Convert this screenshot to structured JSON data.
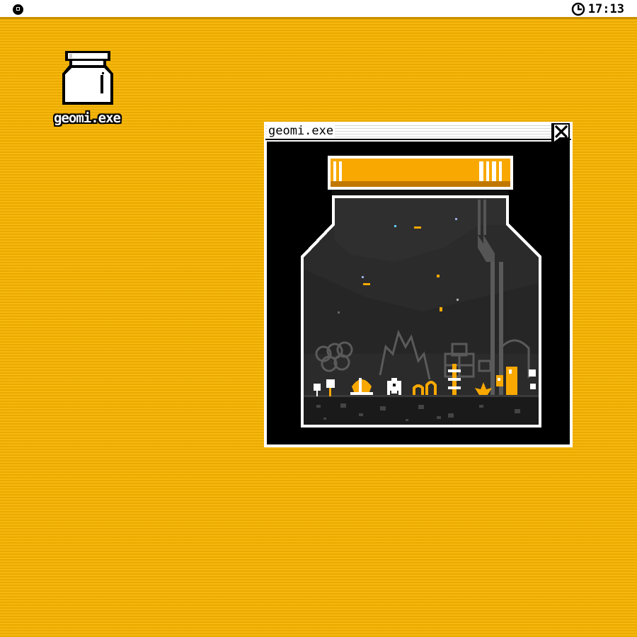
{
  "menubar": {
    "logo_icon": "circle-logo-icon",
    "clock_icon": "clock-icon",
    "time": "17:13"
  },
  "desktop": {
    "icons": [
      {
        "label": "geomi.exe",
        "icon": "jar-icon"
      }
    ]
  },
  "window": {
    "title": "geomi.exe",
    "close_icon": "close-flag-icon",
    "scene": "terrarium-jar"
  },
  "colors": {
    "desktop_bg": "#f6b300",
    "accent_orange": "#f8a800",
    "jar_inside": "#2a2a2a",
    "white": "#ffffff",
    "black": "#000000"
  }
}
